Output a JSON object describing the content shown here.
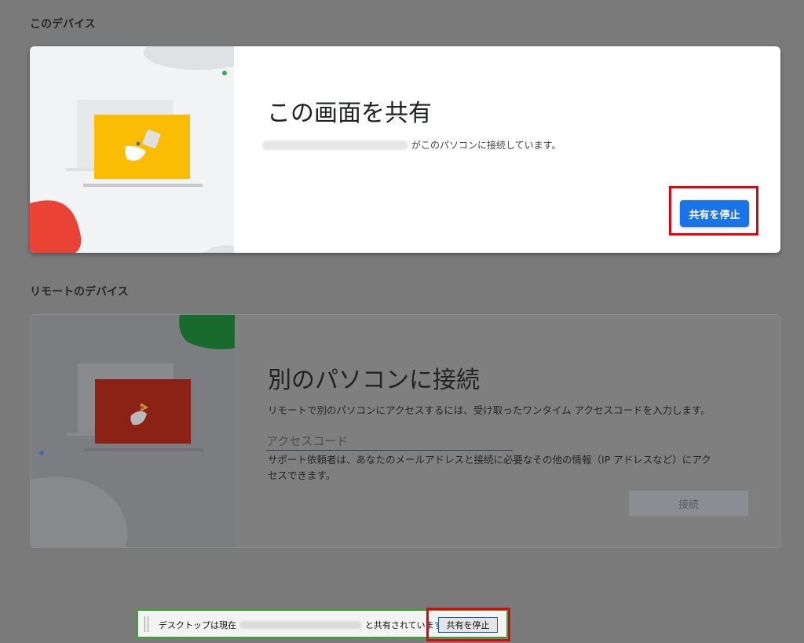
{
  "this_device": {
    "section_title": "このデバイス",
    "card_title": "この画面を共有",
    "status_suffix": "がこのパソコンに接続しています。",
    "stop_button": "共有を停止"
  },
  "remote_device": {
    "section_title": "リモートのデバイス",
    "card_title": "別のパソコンに接続",
    "description": "リモートで別のパソコンにアクセスするには、受け取ったワンタイム アクセスコードを入力します。",
    "access_code_placeholder": "アクセスコード",
    "helper_line1": "サポート依頼者は、あなたのメールアドレスと接続に必要なその他の情報（IP アドレスなど）にアク",
    "helper_line2": "セスできます。",
    "connect_button": "接続"
  },
  "share_bar": {
    "prefix": "デスクトップは現在",
    "suffix": "と共有されています。",
    "stop_button": "共有を停止"
  },
  "colors": {
    "primary_blue": "#1a73e8",
    "highlight_red": "#e8000f",
    "highlight_green": "#36a832"
  }
}
